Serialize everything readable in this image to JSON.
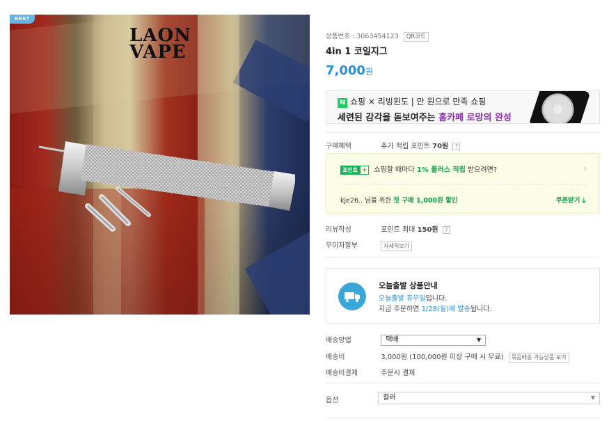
{
  "top": {
    "text": "",
    "right_text": ""
  },
  "gallery": {
    "badge": "BEST",
    "logo_line1": "LAON",
    "logo_line2": "VAPE"
  },
  "product": {
    "number_label": "상품번호 : 3063454123",
    "qr_label": "QR코드",
    "title": "4in 1 코일지그",
    "price": "7,000",
    "price_unit": "원"
  },
  "banner": {
    "n_logo": "N",
    "line1": "쇼핑 × 리빙윈도 | 만 원으로 만족 쇼핑",
    "line2_prefix": "세련된 감각을 돋보여주는 ",
    "line2_bold": "홈카페 로망의 완성"
  },
  "benefits": {
    "label": "구매혜택",
    "value_prefix": "추가 적립 포인트 ",
    "value_bold": "70원",
    "point_badge": "포인트",
    "point_plus": "+",
    "line1_prefix": "쇼핑할 때마다 ",
    "line1_green": "1% 플러스 적립",
    "line1_suffix": " 받으려면?",
    "line2_prefix": "kje26.. 님을 위한 ",
    "line2_green": "첫 구매 1,000원 할인",
    "coupon_label": "쿠폰받기 ⤓"
  },
  "review": {
    "label": "리뷰작성",
    "value_prefix": "포인트 최대 ",
    "value_bold": "150원"
  },
  "installment": {
    "label": "무이자할부",
    "button": "자세히보기"
  },
  "today_ship": {
    "title": "오늘출발 상품안내",
    "line2_blue": "오늘출발 휴무일",
    "line2_suffix": "입니다.",
    "line3_prefix": "지금 주문하면 ",
    "line3_blue": "1/28(월)에 발송",
    "line3_suffix": "됩니다."
  },
  "shipping": {
    "method_label": "배송방법",
    "method_value": "택배",
    "fee_label": "배송비",
    "fee_value": "3,000원 (100,000원 이상 구매 시 무료)",
    "bundle_button": "묶음배송 가능상품 보기",
    "pay_label": "배송비결제",
    "pay_value": "주문시 결제"
  },
  "option": {
    "label": "옵션",
    "value": "컬러"
  },
  "colors": {
    "accent": "#2a8fd8",
    "green": "#0fa24a",
    "purple": "#8b2fb3"
  }
}
